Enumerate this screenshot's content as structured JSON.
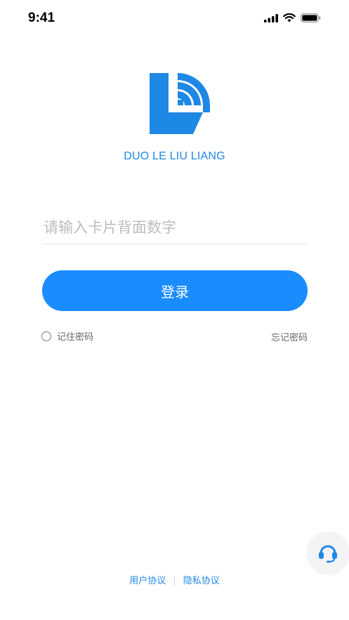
{
  "status_bar": {
    "time": "9:41"
  },
  "brand": {
    "name": "DUO LE LIU LIANG",
    "color": "#1e88e5"
  },
  "login_form": {
    "card_input": {
      "placeholder": "请输入卡片背面数字",
      "value": ""
    },
    "login_button": "登录",
    "remember_label": "记住密码",
    "forgot_label": "忘记密码"
  },
  "support": {
    "icon": "headset-icon"
  },
  "footer": {
    "user_agreement": "用户协议",
    "divider": "|",
    "privacy_agreement": "隐私协议"
  },
  "colors": {
    "primary": "#1a8cff",
    "link": "#1e88e5"
  }
}
